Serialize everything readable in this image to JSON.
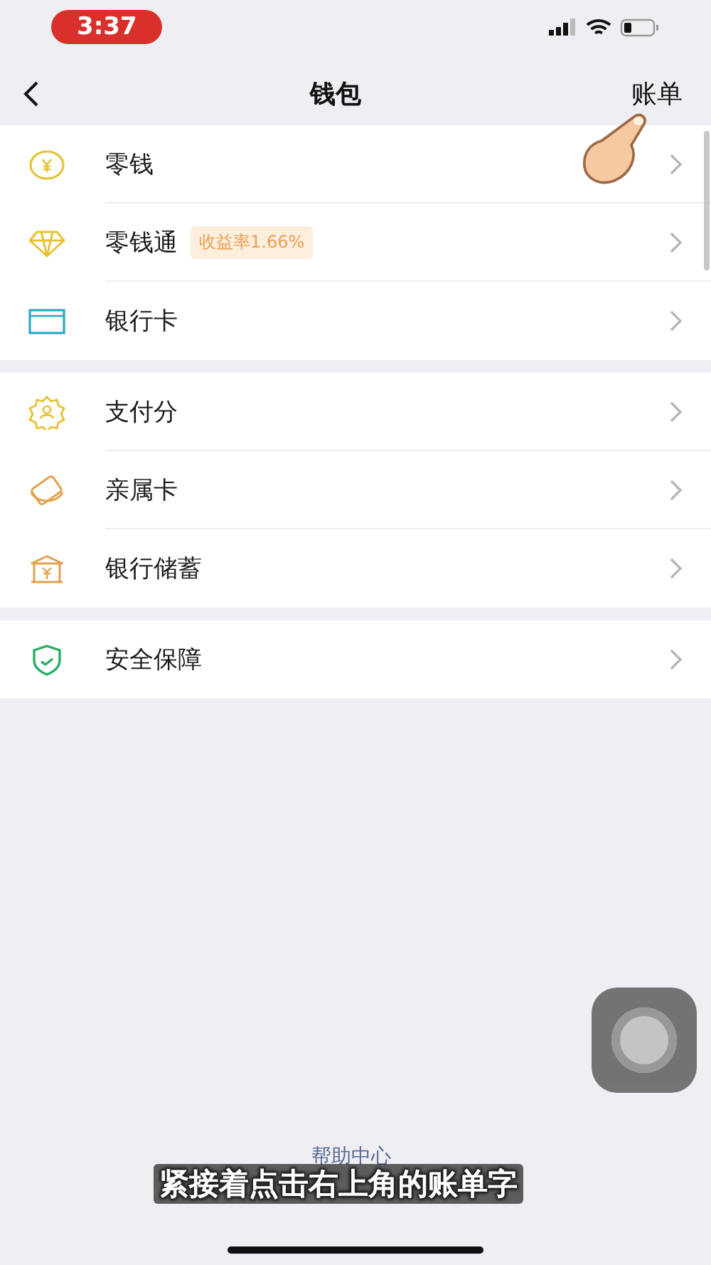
{
  "status_bar": {
    "time": "3:37"
  },
  "nav": {
    "title": "钱包",
    "action": "账单"
  },
  "groups": [
    {
      "rows": [
        {
          "label": "零钱"
        },
        {
          "label": "零钱通",
          "badge": "收益率1.66%"
        },
        {
          "label": "银行卡"
        }
      ]
    },
    {
      "rows": [
        {
          "label": "支付分"
        },
        {
          "label": "亲属卡"
        },
        {
          "label": "银行储蓄"
        }
      ]
    },
    {
      "rows": [
        {
          "label": "安全保障"
        }
      ]
    }
  ],
  "help_link": "帮助中心",
  "caption": "紧接着点击右上角的账单字"
}
